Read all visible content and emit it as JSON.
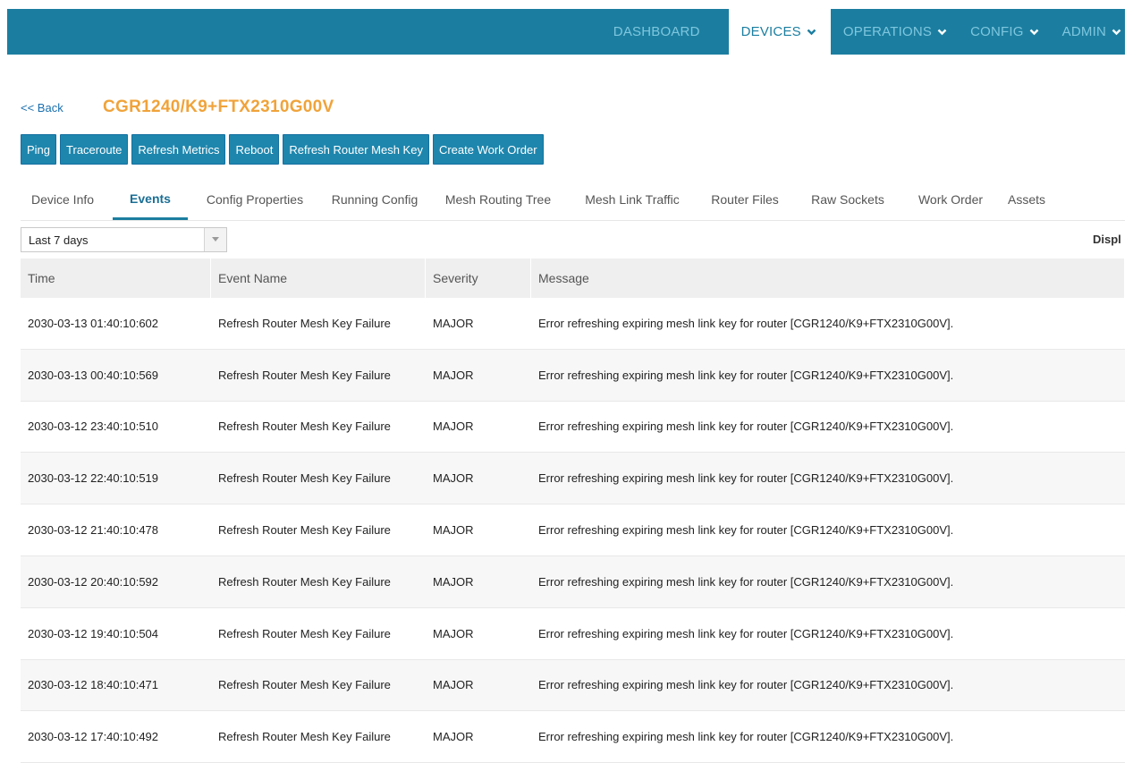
{
  "nav": {
    "items": [
      {
        "label": "DASHBOARD",
        "dropdown": false,
        "active": false
      },
      {
        "label": "DEVICES",
        "dropdown": true,
        "active": true
      },
      {
        "label": "OPERATIONS",
        "dropdown": true,
        "active": false
      },
      {
        "label": "CONFIG",
        "dropdown": true,
        "active": false
      },
      {
        "label": "ADMIN",
        "dropdown": true,
        "active": false
      }
    ]
  },
  "header": {
    "back_label": "<< Back",
    "device_title": "CGR1240/K9+FTX2310G00V"
  },
  "actions": [
    "Ping",
    "Traceroute",
    "Refresh Metrics",
    "Reboot",
    "Refresh Router Mesh Key",
    "Create Work Order"
  ],
  "tabs": [
    {
      "label": "Device Info",
      "active": false
    },
    {
      "label": "Events",
      "active": true
    },
    {
      "label": "Config Properties",
      "active": false
    },
    {
      "label": "Running Config",
      "active": false
    },
    {
      "label": "Mesh Routing Tree",
      "active": false
    },
    {
      "label": "Mesh Link Traffic",
      "active": false
    },
    {
      "label": "Router Files",
      "active": false
    },
    {
      "label": "Raw Sockets",
      "active": false
    },
    {
      "label": "Work Order",
      "active": false
    },
    {
      "label": "Assets",
      "active": false
    }
  ],
  "filter": {
    "selected": "Last 7 days",
    "display_label_partial": "Displ"
  },
  "table": {
    "columns": [
      "Time",
      "Event Name",
      "Severity",
      "Message"
    ],
    "rows": [
      {
        "time": "2030-03-13 01:40:10:602",
        "event": "Refresh Router Mesh Key Failure",
        "severity": "MAJOR",
        "message": "Error refreshing expiring mesh link key for router [CGR1240/K9+FTX2310G00V]."
      },
      {
        "time": "2030-03-13 00:40:10:569",
        "event": "Refresh Router Mesh Key Failure",
        "severity": "MAJOR",
        "message": "Error refreshing expiring mesh link key for router [CGR1240/K9+FTX2310G00V]."
      },
      {
        "time": "2030-03-12 23:40:10:510",
        "event": "Refresh Router Mesh Key Failure",
        "severity": "MAJOR",
        "message": "Error refreshing expiring mesh link key for router [CGR1240/K9+FTX2310G00V]."
      },
      {
        "time": "2030-03-12 22:40:10:519",
        "event": "Refresh Router Mesh Key Failure",
        "severity": "MAJOR",
        "message": "Error refreshing expiring mesh link key for router [CGR1240/K9+FTX2310G00V]."
      },
      {
        "time": "2030-03-12 21:40:10:478",
        "event": "Refresh Router Mesh Key Failure",
        "severity": "MAJOR",
        "message": "Error refreshing expiring mesh link key for router [CGR1240/K9+FTX2310G00V]."
      },
      {
        "time": "2030-03-12 20:40:10:592",
        "event": "Refresh Router Mesh Key Failure",
        "severity": "MAJOR",
        "message": "Error refreshing expiring mesh link key for router [CGR1240/K9+FTX2310G00V]."
      },
      {
        "time": "2030-03-12 19:40:10:504",
        "event": "Refresh Router Mesh Key Failure",
        "severity": "MAJOR",
        "message": "Error refreshing expiring mesh link key for router [CGR1240/K9+FTX2310G00V]."
      },
      {
        "time": "2030-03-12 18:40:10:471",
        "event": "Refresh Router Mesh Key Failure",
        "severity": "MAJOR",
        "message": "Error refreshing expiring mesh link key for router [CGR1240/K9+FTX2310G00V]."
      },
      {
        "time": "2030-03-12 17:40:10:492",
        "event": "Refresh Router Mesh Key Failure",
        "severity": "MAJOR",
        "message": "Error refreshing expiring mesh link key for router [CGR1240/K9+FTX2310G00V]."
      }
    ]
  },
  "colors": {
    "topbar": "#1b7ea0",
    "nav_text": "#7fc6de",
    "title_accent": "#f0a33a",
    "button": "#1e86ad"
  },
  "icons": {
    "dropdown": "chevron-down-icon",
    "select": "select-arrow-icon"
  }
}
